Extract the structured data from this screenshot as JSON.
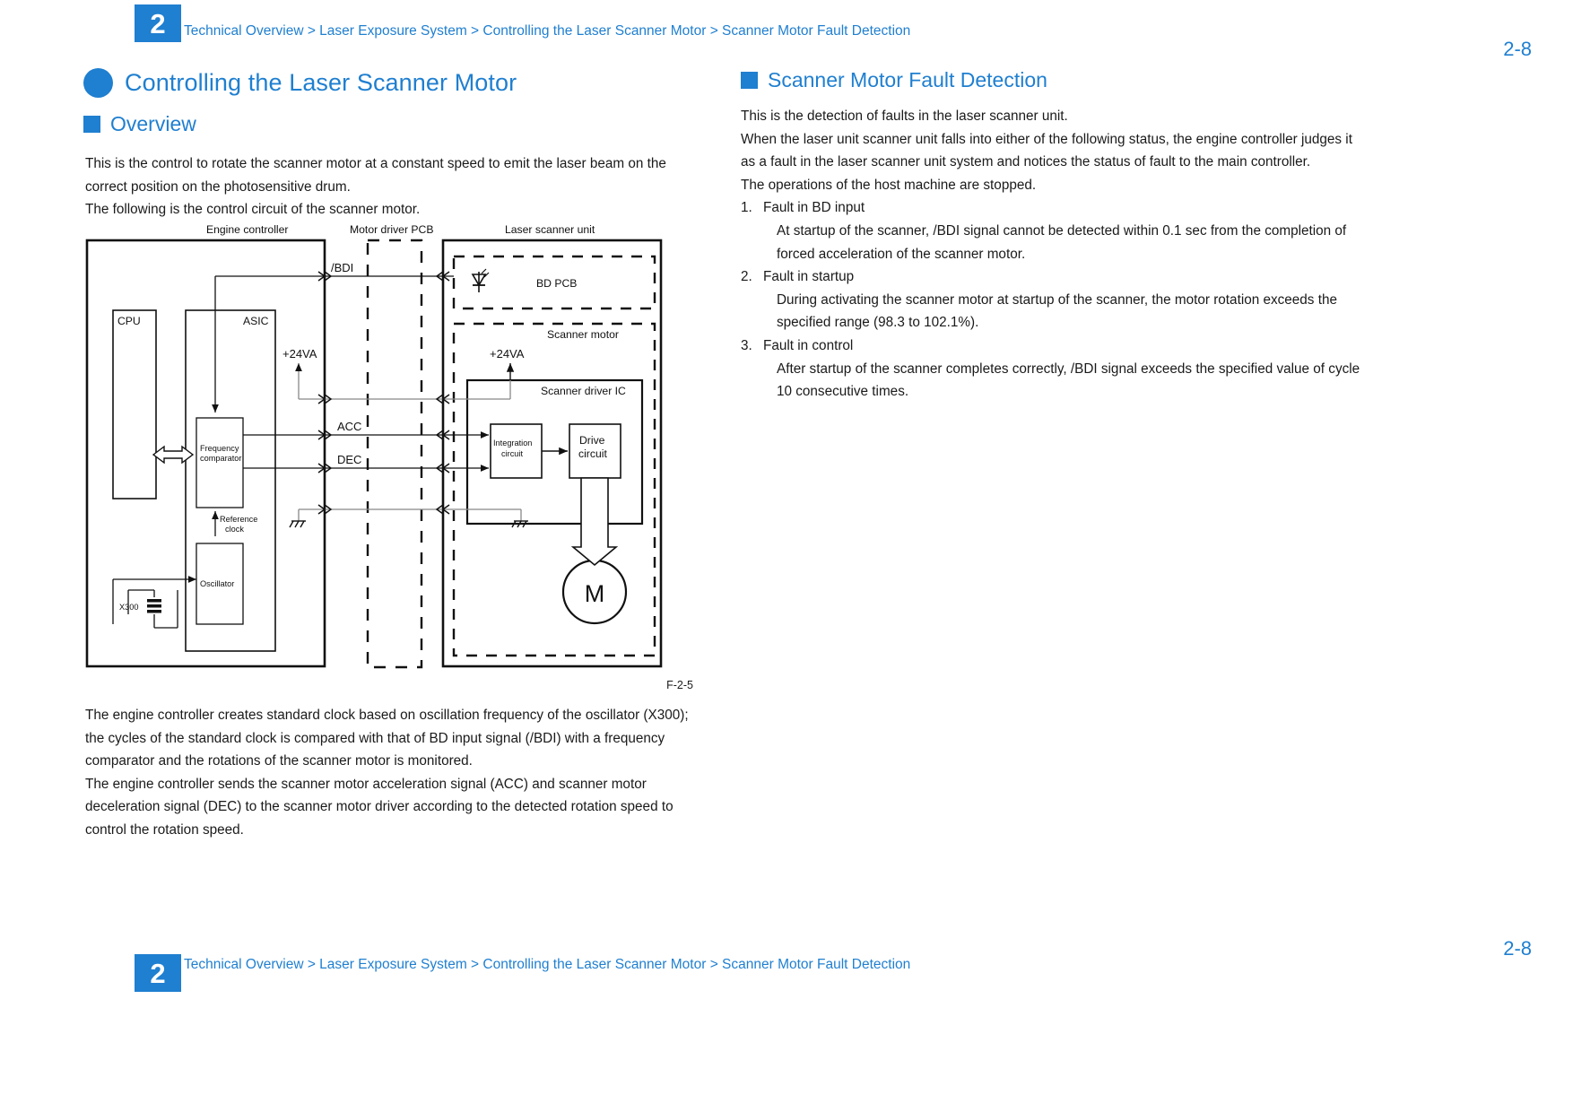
{
  "header": {
    "chapter": "2",
    "breadcrumb": "Technical Overview > Laser Exposure System > Controlling the Laser Scanner Motor > Scanner Motor Fault Detection",
    "page_number": "2-8"
  },
  "footer": {
    "chapter": "2",
    "breadcrumb": "Technical Overview > Laser Exposure System > Controlling the Laser Scanner Motor > Scanner Motor Fault Detection",
    "page_number": "2-8"
  },
  "theme": {
    "accent": "#1f7fd0",
    "text": "#1a1a1a",
    "background": "#ffffff"
  },
  "left_column": {
    "title": "Controlling the Laser Scanner Motor",
    "section_heading": "Overview",
    "intro_paragraph": "This is the control to rotate the scanner motor at a constant speed to emit the laser beam on the correct position on the photosensitive drum.\nThe following is the control circuit of the scanner motor.",
    "figure_caption": "F-2-5",
    "post_figure_paragraph": "The engine controller creates standard clock based on oscillation frequency of the oscillator (X300); the cycles of the standard clock is compared with that of BD input signal (/BDI) with a frequency comparator and the rotations of the scanner motor is monitored.\nThe engine controller sends the scanner motor acceleration signal (ACC) and scanner motor deceleration signal (DEC) to the scanner motor driver according to the detected rotation speed to control the rotation speed."
  },
  "right_column": {
    "section_heading": "Scanner Motor Fault Detection",
    "intro_paragraph": "This is the detection of faults in the laser scanner unit.\nWhen the laser unit scanner unit falls into either of the following status, the engine controller judges it as a fault in the laser scanner unit system and notices the status of fault to the main controller.\nThe operations of the host machine are stopped.",
    "faults": [
      {
        "number": "1.",
        "title": "Fault in BD input",
        "detail": "At startup of the scanner, /BDI signal cannot be detected within 0.1 sec from the completion of forced acceleration of the scanner motor."
      },
      {
        "number": "2.",
        "title": "Fault in startup",
        "detail": "During activating the scanner motor at startup of the scanner, the motor rotation exceeds the specified range (98.3 to 102.1%)."
      },
      {
        "number": "3.",
        "title": "Fault in control",
        "detail": "After startup of the scanner completes correctly, /BDI signal exceeds the specified value of cycle 10 consecutive times."
      }
    ]
  },
  "figure": {
    "id": "F-2-5",
    "group_labels": {
      "engine_controller": "Engine controller",
      "motor_driver_pcb": "Motor driver PCB",
      "laser_scanner_unit": "Laser scanner unit",
      "bd_pcb": "BD PCB",
      "scanner_motor": "Scanner motor",
      "scanner_driver_ic": "Scanner driver IC"
    },
    "blocks": {
      "cpu": "CPU",
      "asic": "ASIC",
      "frequency_comparator": "Frequency\ncomparator",
      "frequency_comparator_line1": "Frequency",
      "frequency_comparator_line2": "comparator",
      "oscillator": "Oscillator",
      "integration_circuit_line1": "Integration",
      "integration_circuit_line2": "circuit",
      "drive_circuit_line1": "Drive",
      "drive_circuit_line2": "circuit",
      "motor": "M"
    },
    "annotations": {
      "reference_clock_line1": "Reference",
      "reference_clock_line2": "clock",
      "crystal": "X300"
    },
    "signals": [
      {
        "name": "/BDI"
      },
      {
        "name": "+24VA"
      },
      {
        "name": "ACC"
      },
      {
        "name": "DEC"
      },
      {
        "name": "+24VA"
      }
    ]
  }
}
